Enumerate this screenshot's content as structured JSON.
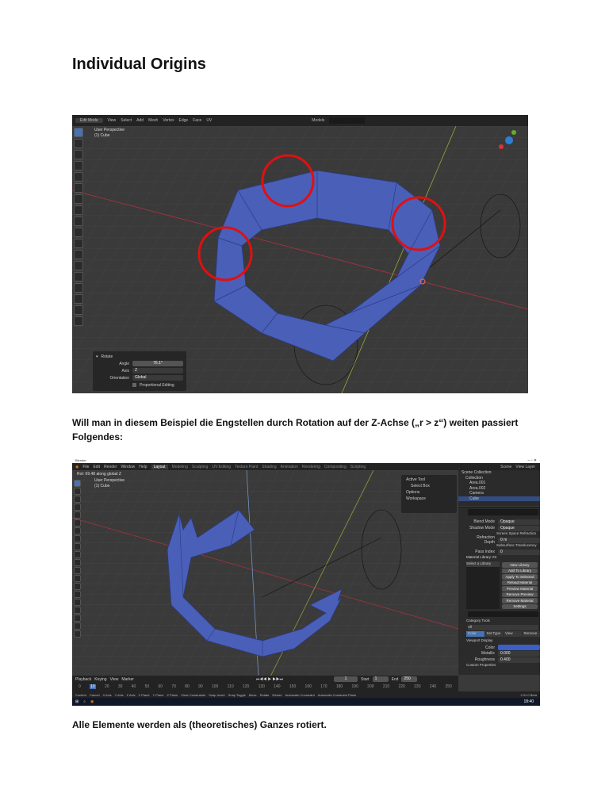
{
  "title": "Individual Origins",
  "paragraph1": "Will man in diesem Beispiel die Engstellen durch Rotation auf der Z-Achse („r > z“) weiten passiert Folgendes:",
  "paragraph2": "Alle Elemente werden als (theoretisches) Ganzes rotiert.",
  "shot1": {
    "mode": "Edit Mode",
    "menu": [
      "View",
      "Select",
      "Add",
      "Mesh",
      "Vertex",
      "Edge",
      "Face",
      "UV"
    ],
    "models": "Models",
    "view_label": "User Perspective",
    "object_label": "(1) Cube",
    "rotate": {
      "title": "Rotate",
      "angle_label": "Angle",
      "angle": "76.1°",
      "axis_label": "Axis",
      "axis": "Z",
      "orientation_label": "Orientation",
      "orientation": "Global",
      "proportional": "Proportional Editing"
    },
    "colors": {
      "mesh": "#4a5fb8",
      "highlight": "#e01010",
      "x_axis": "#b03040",
      "y_axis": "#9aa83a"
    }
  },
  "shot2": {
    "window_title": "Blender",
    "menu": [
      "File",
      "Edit",
      "Render",
      "Window",
      "Help"
    ],
    "workspaces": [
      "Layout",
      "Modeling",
      "Sculpting",
      "UV Editing",
      "Texture Paint",
      "Shading",
      "Animation",
      "Rendering",
      "Compositing",
      "Scripting"
    ],
    "scene": "Scene",
    "view_layer": "View Layer",
    "view_label": "User Perspective",
    "object_label": "(1) Cube",
    "status_top": "Rot: 69.48 along global Z",
    "outliner": [
      "Scene Collection",
      "Collection",
      "Area.001",
      "Area.002",
      "Camera",
      "Cube"
    ],
    "sidepanel": [
      "Active Tool",
      "Select Box",
      "Options",
      "Workspace"
    ],
    "props": {
      "blend_label": "Blend Mode",
      "blend": "Opaque",
      "shadow_label": "Shadow Mode",
      "shadow": "Opaque",
      "refr_label": "Refraction Depth",
      "refr": "0 m",
      "pass_label": "Pass Index",
      "pass": "0",
      "screen_space": "Screen Space Refraction",
      "subsurface": "Subsurface Translucency",
      "library": "Material Library VX",
      "select_lib": "Select a Library",
      "lib_buttons": [
        "New Library",
        "Add To Library",
        "Apply To Selected",
        "Reload Material",
        "Preview Material",
        "Remove Preview",
        "Remove Material",
        "Settings"
      ],
      "category": "Category Tools",
      "all": "All",
      "tabs": [
        "Color",
        "Set Type",
        "View",
        "Remove"
      ],
      "viewport_display": "Viewport Display",
      "color_label": "Color",
      "metallic_label": "Metallic",
      "metallic": "0.000",
      "roughness_label": "Roughness",
      "roughness": "0.400",
      "custom": "Custom Properties"
    },
    "timeline": {
      "menu": [
        "Playback",
        "Keying",
        "View",
        "Marker"
      ],
      "current": "1",
      "start_label": "Start",
      "start": "1",
      "end_label": "End",
      "end": "250",
      "ticks": [
        "0",
        "10",
        "20",
        "30",
        "40",
        "50",
        "60",
        "70",
        "80",
        "90",
        "100",
        "110",
        "120",
        "130",
        "140",
        "150",
        "160",
        "170",
        "180",
        "190",
        "200",
        "210",
        "220",
        "230",
        "240",
        "250"
      ]
    },
    "statusbar": [
      "Confirm",
      "Cancel",
      "X Axis",
      "Y Axis",
      "Z Axis",
      "X Plane",
      "Y Plane",
      "Z Plane",
      "Clear Constraints",
      "Snap Invert",
      "Snap Toggle",
      "Move",
      "Rotate",
      "Resize",
      "Automatic Constraint",
      "Automatic Constraint Plane"
    ],
    "version": "2.91.0 Beta",
    "clock": "18:40"
  }
}
